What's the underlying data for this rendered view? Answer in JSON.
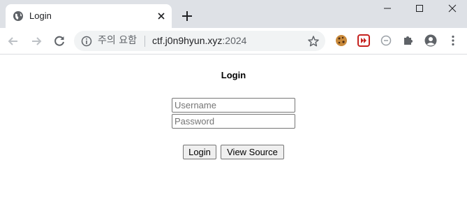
{
  "tab": {
    "title": "Login",
    "favicon": "globe-icon"
  },
  "toolbar": {
    "security_label": "주의 요함",
    "url_host": "ctf.j0n9hyun.xyz",
    "url_port": ":2024"
  },
  "page": {
    "heading": "Login",
    "username_placeholder": "Username",
    "username_value": "",
    "password_placeholder": "Password",
    "password_value": "",
    "login_button": "Login",
    "view_source_button": "View Source"
  },
  "colors": {
    "tabstrip_bg": "#dee1e6",
    "omnibox_bg": "#f1f3f4",
    "extension_red": "#c5221f"
  }
}
